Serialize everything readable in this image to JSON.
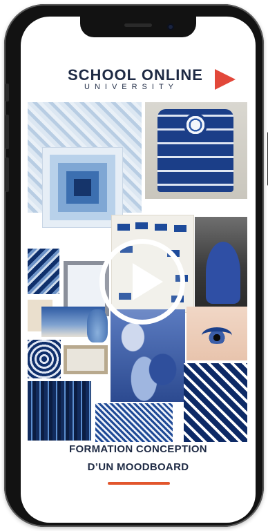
{
  "brand": {
    "title": "SCHOOL ONLINE",
    "subtitle": "UNIVERSITY",
    "accent_color": "#e2562d"
  },
  "media": {
    "thumbnail": "blue-moodboard-collage",
    "play_icon": "play-icon"
  },
  "caption": {
    "line1": "FORMATION CONCEPTION",
    "line2": "D’UN MOODBOARD"
  }
}
